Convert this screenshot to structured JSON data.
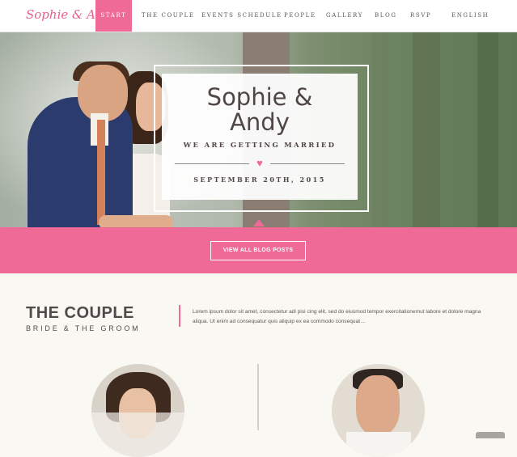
{
  "nav": {
    "logo": "Sophie & Andy",
    "items": [
      {
        "label": "START",
        "active": true
      },
      {
        "label": "THE COUPLE"
      },
      {
        "label": "EVENTS SCHEDULE"
      },
      {
        "label": "PEOPLE"
      },
      {
        "label": "GALLERY"
      },
      {
        "label": "BLOG"
      },
      {
        "label": "RSVP"
      },
      {
        "label": "ENGLISH"
      }
    ]
  },
  "hero": {
    "names": "Sophie &\nAndy",
    "subtitle": "WE ARE GETTING MARRIED",
    "date": "SEPTEMBER 20TH, 2015",
    "heart": "♥"
  },
  "blog_button": "VIEW ALL BLOG POSTS",
  "couple": {
    "title": "THE COUPLE",
    "subtitle": "BRIDE & THE GROOM",
    "text": "Lorem ipsum dolor sit amet, consectetur adi pisi cing elit, sed do eiusmod tempor exercitationemut labore et dolore magna aliqua. Ut enim ad consequatur quis aliquip ex ea commodo consequat…"
  },
  "colors": {
    "accent": "#ef6a97",
    "text": "#52494a",
    "background": "#faf8f2"
  }
}
